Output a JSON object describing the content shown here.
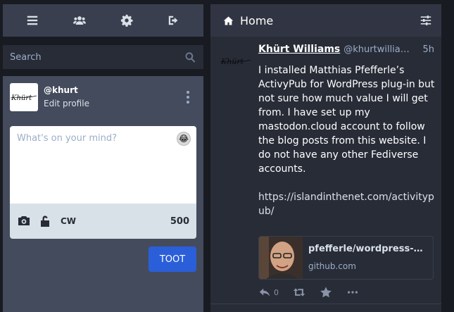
{
  "nav": {
    "items": [
      "menu-icon",
      "users-icon",
      "gear-icon",
      "sign-out-icon"
    ]
  },
  "search": {
    "placeholder": "Search"
  },
  "compose": {
    "account": "@khurt",
    "edit_profile": "Edit profile",
    "avatar_text": "Khürt",
    "placeholder": "What's on your mind?",
    "cw_label": "CW",
    "char_count": "500",
    "toot_label": "TOOT"
  },
  "column": {
    "title": "Home"
  },
  "status": {
    "avatar_text": "Khürt",
    "display_name": "Khürt Williams",
    "username": "@khurtwilliams@islandinthenet.com",
    "time": "5h",
    "paragraph": "I installed Matthias Pfefferle’s ActivyPub for WordPress plug-in but not sure how much value I will get from. I have set up my mastodon.cloud account to follow the blog posts from this website. I do not have any other Fediverse accounts.",
    "link": "https://islandinthenet.com/activitypub/",
    "card": {
      "title": "pfefferle/wordpress-activitypub",
      "domain": "github.com"
    },
    "reply_count": "0"
  },
  "colors": {
    "accent": "#2b5fd9",
    "panel": "#444b5d",
    "background": "#191b22"
  }
}
